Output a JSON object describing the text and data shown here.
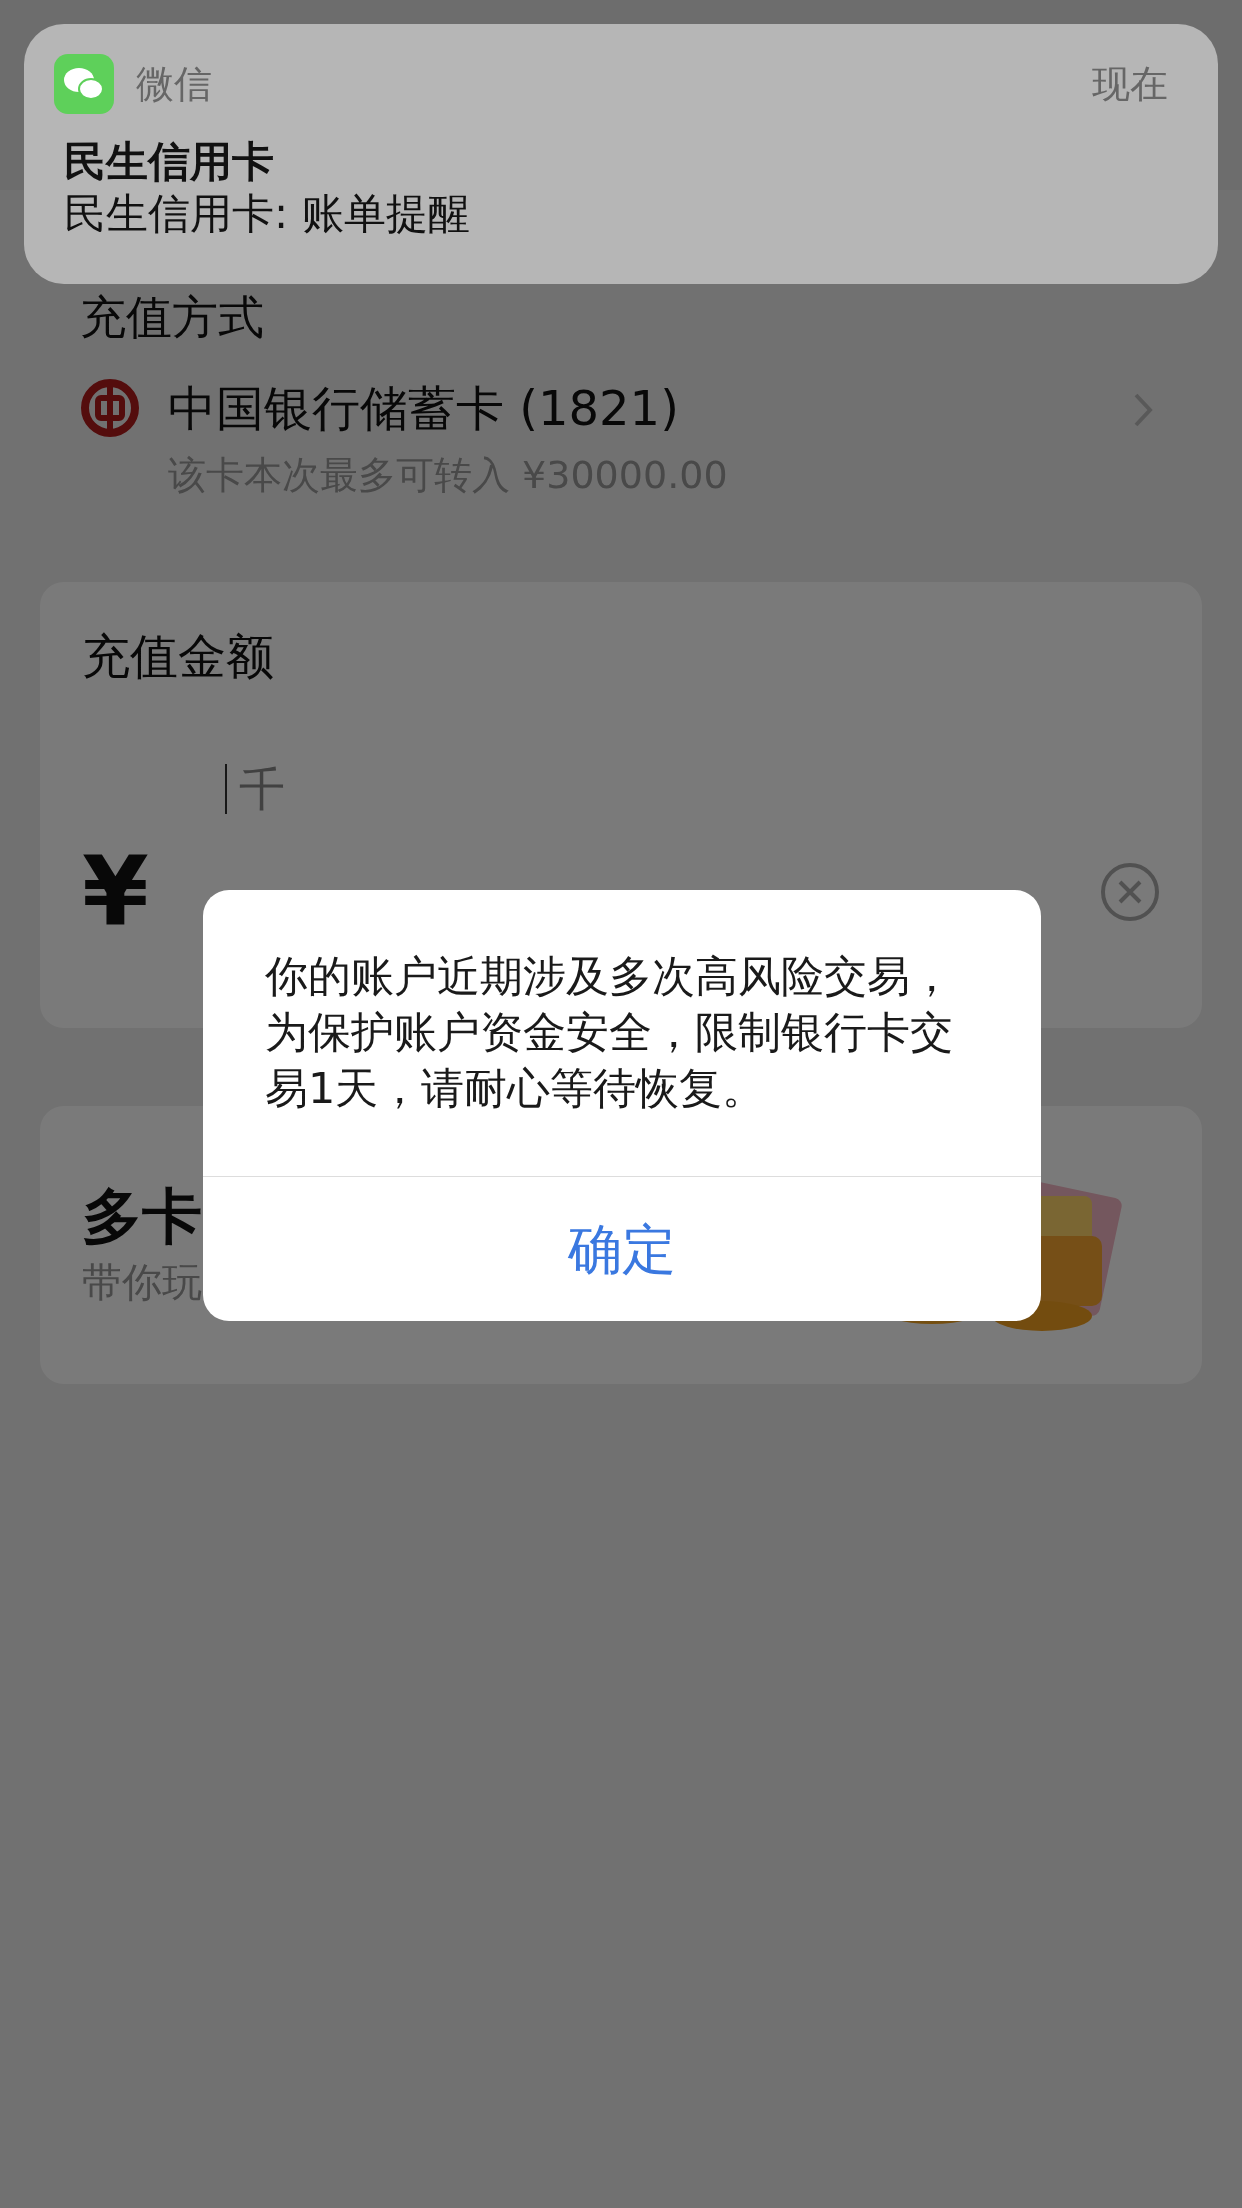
{
  "notification": {
    "app": "微信",
    "time": "现在",
    "title": "民生信用卡",
    "body": "民生信用卡: 账单提醒"
  },
  "payment_method": {
    "title": "充值方式",
    "bank": "中国银行储蓄卡 (1821)",
    "limit": "该卡本次最多可转入 ¥30000.00"
  },
  "amount": {
    "title": "充值金额",
    "unit_hint": "千",
    "currency": "¥"
  },
  "promo": {
    "title": "多卡",
    "subtitle": "带你玩"
  },
  "dialog": {
    "message": "你的账户近期涉及多次高风险交易，为保护账户资金安全，限制银行卡交易1天，请耐心等待恢复。",
    "buttons": [
      "确定"
    ]
  }
}
